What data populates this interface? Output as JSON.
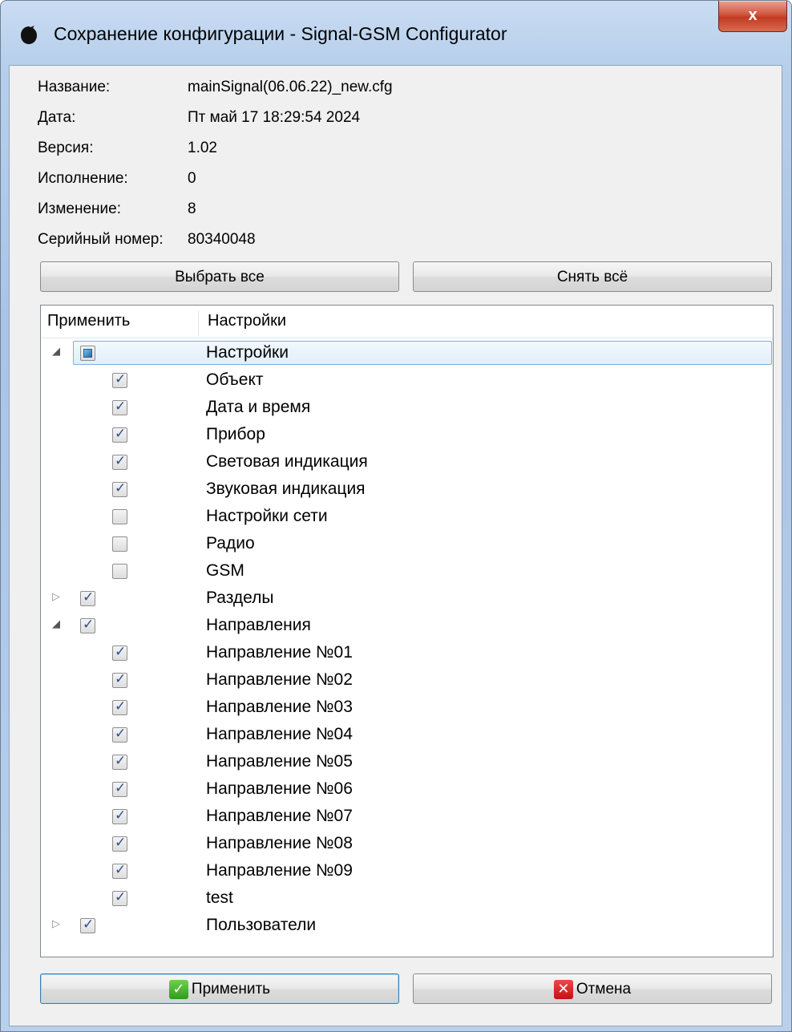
{
  "window": {
    "title": "Сохранение конфигурации - Signal-GSM Configurator",
    "close_glyph": "x"
  },
  "info": [
    {
      "label": "Название:",
      "value": "mainSignal(06.06.22)_new.cfg"
    },
    {
      "label": "Дата:",
      "value": "Пт май 17 18:29:54 2024"
    },
    {
      "label": "Версия:",
      "value": "1.02"
    },
    {
      "label": "Исполнение:",
      "value": "0"
    },
    {
      "label": "Изменение:",
      "value": "8"
    },
    {
      "label": "Серийный номер:",
      "value": "80340048"
    }
  ],
  "buttons": {
    "select_all": "Выбрать все",
    "deselect_all": "Снять всё",
    "apply": "Применить",
    "cancel": "Отмена"
  },
  "tree": {
    "columns": [
      "Применить",
      "Настройки"
    ],
    "rows": [
      {
        "label": "Настройки",
        "level": 0,
        "expander": "expanded",
        "state": "partial",
        "selected": true
      },
      {
        "label": "Объект",
        "level": 1,
        "expander": "none",
        "state": "checked"
      },
      {
        "label": "Дата и время",
        "level": 1,
        "expander": "none",
        "state": "checked"
      },
      {
        "label": "Прибор",
        "level": 1,
        "expander": "none",
        "state": "checked"
      },
      {
        "label": "Световая индикация",
        "level": 1,
        "expander": "none",
        "state": "checked"
      },
      {
        "label": "Звуковая индикация",
        "level": 1,
        "expander": "none",
        "state": "checked"
      },
      {
        "label": "Настройки сети",
        "level": 1,
        "expander": "none",
        "state": "unchecked"
      },
      {
        "label": "Радио",
        "level": 1,
        "expander": "none",
        "state": "unchecked"
      },
      {
        "label": "GSM",
        "level": 1,
        "expander": "none",
        "state": "unchecked"
      },
      {
        "label": "Разделы",
        "level": 0,
        "expander": "collapsed",
        "state": "checked"
      },
      {
        "label": "Направления",
        "level": 0,
        "expander": "expanded",
        "state": "checked"
      },
      {
        "label": "Направление №01",
        "level": 1,
        "expander": "none",
        "state": "checked"
      },
      {
        "label": "Направление №02",
        "level": 1,
        "expander": "none",
        "state": "checked"
      },
      {
        "label": "Направление №03",
        "level": 1,
        "expander": "none",
        "state": "checked"
      },
      {
        "label": "Направление №04",
        "level": 1,
        "expander": "none",
        "state": "checked"
      },
      {
        "label": "Направление №05",
        "level": 1,
        "expander": "none",
        "state": "checked"
      },
      {
        "label": "Направление №06",
        "level": 1,
        "expander": "none",
        "state": "checked"
      },
      {
        "label": "Направление №07",
        "level": 1,
        "expander": "none",
        "state": "checked"
      },
      {
        "label": "Направление №08",
        "level": 1,
        "expander": "none",
        "state": "checked"
      },
      {
        "label": "Направление №09",
        "level": 1,
        "expander": "none",
        "state": "checked"
      },
      {
        "label": "test",
        "level": 1,
        "expander": "none",
        "state": "checked"
      },
      {
        "label": "Пользователи",
        "level": 0,
        "expander": "collapsed",
        "state": "checked"
      }
    ]
  },
  "colors": {
    "selection_border": "#84acdd",
    "apply_icon": "#3aa524",
    "cancel_icon": "#d2161b"
  }
}
